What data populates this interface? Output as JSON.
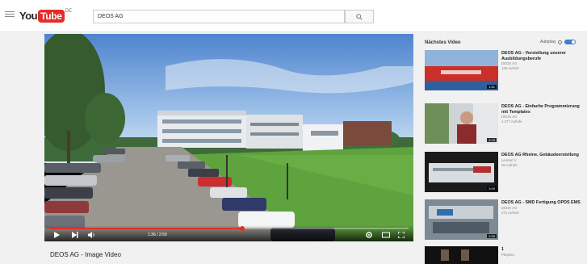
{
  "header": {
    "logo_you": "You",
    "logo_tube": "Tube",
    "logo_sup": "DE",
    "search_value": "DEOS AG"
  },
  "player": {
    "time": "1:36 / 2:59",
    "progress_fraction": 0.537
  },
  "video": {
    "title": "DEOS AG - Image Video"
  },
  "sidebar": {
    "heading": "Nächstes Video",
    "autoplay_label": "Autoplay",
    "items": [
      {
        "title": "DEOS AG - Vorstellung unserer Ausbildungsberufe",
        "channel": "DEOS AG",
        "views": "126 Aufrufe",
        "duration": "1:51"
      },
      {
        "title": "DEOS AG - Einfache Programmierung mit Templates",
        "channel": "DEOS AG",
        "views": "1.277 Aufrufe",
        "duration": "2:16"
      },
      {
        "title": "DEOS AG Rheine, Gebäudeerstellung",
        "channel": "Lennart V",
        "views": "66 Aufrufe",
        "duration": "3:09"
      },
      {
        "title": "DEOS AG - SMD Fertigung OPDS EMS",
        "channel": "DEOS AG",
        "views": "274 Aufrufe",
        "duration": "2:59"
      },
      {
        "title": "1",
        "channel": "Playlists",
        "views": "",
        "duration": ""
      }
    ]
  },
  "colors": {
    "brand_red": "#e52d27",
    "toggle_blue": "#3b82c4"
  }
}
